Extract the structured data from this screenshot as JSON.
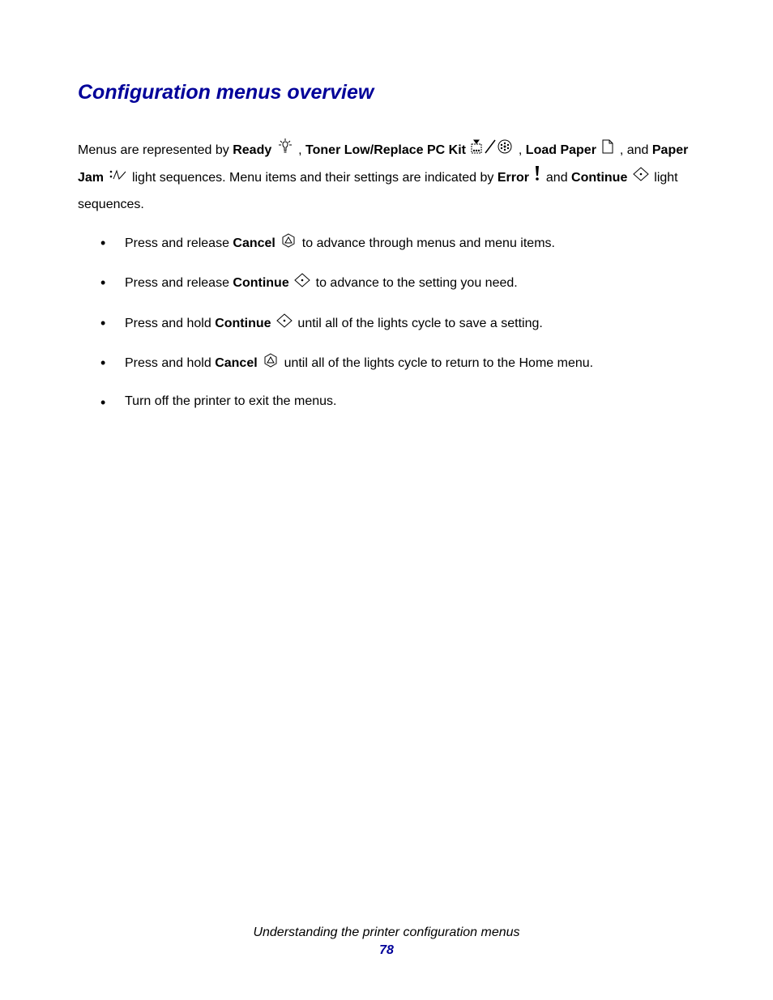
{
  "heading": "Configuration menus overview",
  "para": {
    "t1": "Menus are represented by ",
    "ready": "Ready",
    "t2": ", ",
    "toner": "Toner Low/Replace PC Kit",
    "t3": ", ",
    "load": "Load Paper",
    "t4": ", and ",
    "jam": "Paper Jam",
    "t5": " light sequences. Menu items and their settings are indicated by ",
    "error": "Error",
    "t6": " and ",
    "cont": "Continue",
    "t7": " light sequences."
  },
  "bullets": [
    {
      "a": "Press and release ",
      "b": "Cancel",
      "c": " to advance through menus and menu items.",
      "icon": "cancel"
    },
    {
      "a": "Press and release ",
      "b": "Continue",
      "c": " to advance to the setting you need.",
      "icon": "continue"
    },
    {
      "a": "Press and hold ",
      "b": "Continue",
      "c": " until all of the lights cycle to save a setting.",
      "icon": "continue"
    },
    {
      "a": "Press and hold ",
      "b": "Cancel",
      "c": " until all of the lights cycle to return to the Home menu.",
      "icon": "cancel"
    },
    {
      "a": "Turn off the printer to exit the menus.",
      "b": "",
      "c": "",
      "icon": ""
    }
  ],
  "footer": {
    "title": "Understanding the printer configuration menus",
    "page": "78"
  }
}
